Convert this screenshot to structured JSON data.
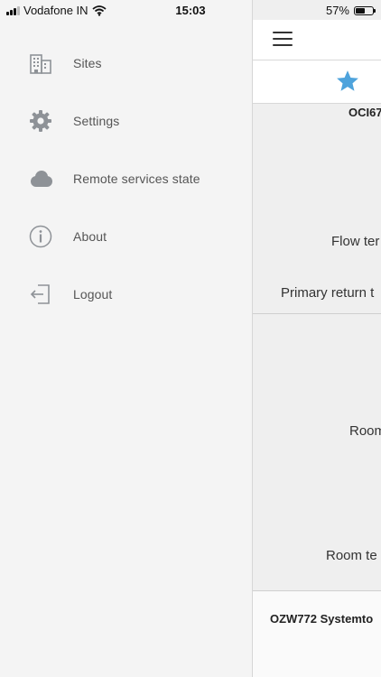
{
  "status_bar": {
    "carrier": "Vodafone IN",
    "time": "15:03",
    "battery_percent": "57%",
    "battery_level": 0.57
  },
  "drawer": {
    "items": [
      {
        "label": "Sites",
        "icon": "building-icon"
      },
      {
        "label": "Settings",
        "icon": "gear-icon"
      },
      {
        "label": "Remote services state",
        "icon": "cloud-icon"
      },
      {
        "label": "About",
        "icon": "info-icon"
      },
      {
        "label": "Logout",
        "icon": "logout-icon"
      }
    ]
  },
  "main": {
    "device_title": "OCI67",
    "labels": [
      "Flow ter",
      "Primary return t",
      "Room",
      "Room te"
    ],
    "footer_title": "OZW772 Systemto"
  },
  "colors": {
    "accent_star": "#4ea3dc",
    "icon_gray": "#8e9297"
  }
}
